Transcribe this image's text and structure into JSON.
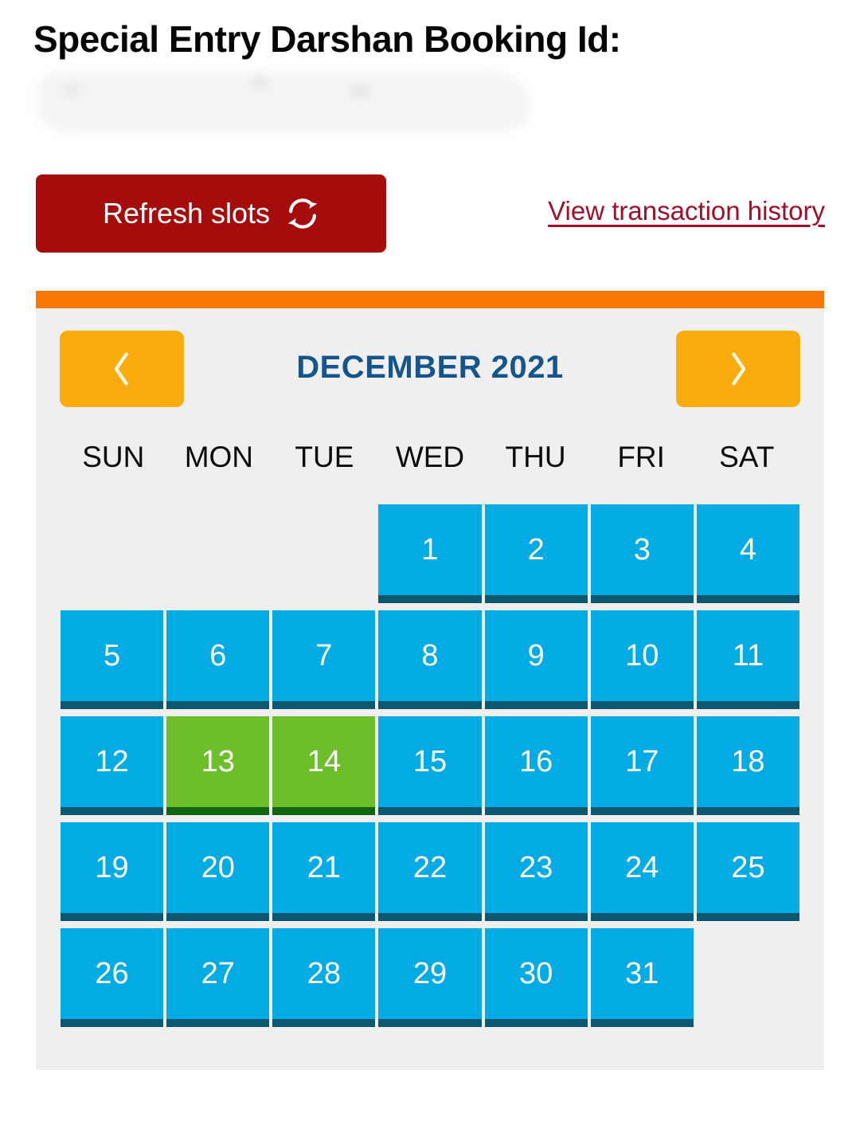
{
  "page": {
    "title": "Special Entry Darshan Booking Id:",
    "booking_id_redacted": ""
  },
  "actions": {
    "refresh_label": "Refresh slots",
    "refresh_icon": "refresh-sync-icon",
    "history_link_label": "View transaction history"
  },
  "calendar": {
    "month_label": "DECEMBER 2021",
    "prev_icon": "chevron-left-icon",
    "next_icon": "chevron-right-icon",
    "weekdays": [
      "SUN",
      "MON",
      "TUE",
      "WED",
      "THU",
      "FRI",
      "SAT"
    ],
    "cells": [
      {
        "day": "",
        "state": "empty"
      },
      {
        "day": "",
        "state": "empty"
      },
      {
        "day": "",
        "state": "empty"
      },
      {
        "day": "1",
        "state": "blue"
      },
      {
        "day": "2",
        "state": "blue"
      },
      {
        "day": "3",
        "state": "blue"
      },
      {
        "day": "4",
        "state": "blue"
      },
      {
        "day": "5",
        "state": "blue"
      },
      {
        "day": "6",
        "state": "blue"
      },
      {
        "day": "7",
        "state": "blue"
      },
      {
        "day": "8",
        "state": "blue"
      },
      {
        "day": "9",
        "state": "blue"
      },
      {
        "day": "10",
        "state": "blue"
      },
      {
        "day": "11",
        "state": "blue"
      },
      {
        "day": "12",
        "state": "blue"
      },
      {
        "day": "13",
        "state": "green"
      },
      {
        "day": "14",
        "state": "green"
      },
      {
        "day": "15",
        "state": "blue"
      },
      {
        "day": "16",
        "state": "blue"
      },
      {
        "day": "17",
        "state": "blue"
      },
      {
        "day": "18",
        "state": "blue"
      },
      {
        "day": "19",
        "state": "blue"
      },
      {
        "day": "20",
        "state": "blue"
      },
      {
        "day": "21",
        "state": "blue"
      },
      {
        "day": "22",
        "state": "blue"
      },
      {
        "day": "23",
        "state": "blue"
      },
      {
        "day": "24",
        "state": "blue"
      },
      {
        "day": "25",
        "state": "blue"
      },
      {
        "day": "26",
        "state": "blue"
      },
      {
        "day": "27",
        "state": "blue"
      },
      {
        "day": "28",
        "state": "blue"
      },
      {
        "day": "29",
        "state": "blue"
      },
      {
        "day": "30",
        "state": "blue"
      },
      {
        "day": "31",
        "state": "blue"
      },
      {
        "day": "",
        "state": "empty"
      }
    ]
  },
  "colors": {
    "brand_red": "#a50d0d",
    "link_red": "#9e1029",
    "topbar_orange": "#f97707",
    "nav_amber": "#faac0d",
    "month_blue": "#14558e",
    "day_blue": "#02abe3",
    "day_blue_border": "#0d5871",
    "day_green": "#6cbe2b",
    "day_green_border": "#11650f",
    "panel_gray": "#efefef"
  }
}
